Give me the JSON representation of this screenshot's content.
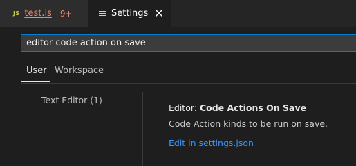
{
  "tabs": [
    {
      "icon": "JS",
      "label": "test.js",
      "badge": "9+",
      "icon_color": "#cbcb41",
      "label_color": "#f48771"
    },
    {
      "label": "Settings"
    }
  ],
  "search": {
    "value": "editor code action on save"
  },
  "scopes": [
    "User",
    "Workspace"
  ],
  "toc": {
    "item": "Text Editor (1)"
  },
  "setting": {
    "category": "Editor: ",
    "name": "Code Actions On Save",
    "description": "Code Action kinds to be run on save.",
    "link": "Edit in settings.json"
  },
  "colors": {
    "accent": "#007fd4",
    "link": "#3794ff",
    "background": "#1e1e1e"
  }
}
